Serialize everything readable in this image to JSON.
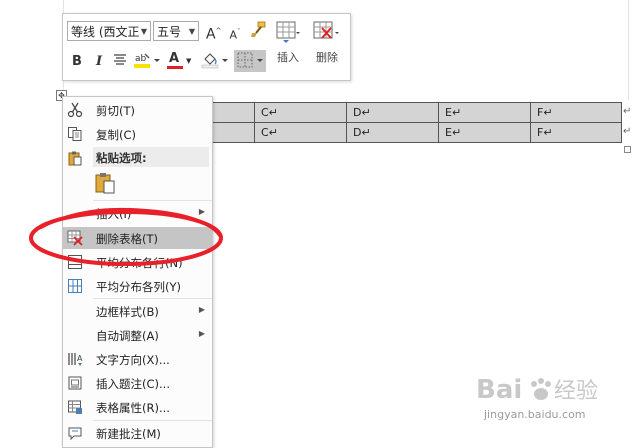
{
  "toolbar": {
    "font_name": "等线 (西文正",
    "font_size": "五号",
    "grow_font": "A",
    "shrink_font": "A",
    "bold": "B",
    "italic": "I",
    "font_color_letter": "A",
    "insert_label": "插入",
    "delete_label": "删除"
  },
  "table": {
    "rows": [
      [
        "",
        "C↵",
        "D↵",
        "E↵",
        "F↵"
      ],
      [
        "",
        "C↵",
        "D↵",
        "E↵",
        "F↵"
      ]
    ],
    "row_end_mark": "↵"
  },
  "context_menu": {
    "items": [
      {
        "label": "剪切(T)",
        "icon": "scissors-icon"
      },
      {
        "label": "复制(C)",
        "icon": "copy-icon"
      },
      {
        "label": "粘贴选项:",
        "icon": "clipboard-icon"
      },
      {
        "label": "插入(I)",
        "icon": "",
        "submenu": true
      },
      {
        "label": "删除表格(T)",
        "icon": "delete-table-icon"
      },
      {
        "label": "平均分布各行(N)",
        "icon": "distribute-rows-icon"
      },
      {
        "label": "平均分布各列(Y)",
        "icon": "distribute-columns-icon"
      },
      {
        "label": "边框样式(B)",
        "icon": "",
        "submenu": true
      },
      {
        "label": "自动调整(A)",
        "icon": "",
        "submenu": true
      },
      {
        "label": "文字方向(X)...",
        "icon": "text-direction-icon"
      },
      {
        "label": "插入题注(C)...",
        "icon": "caption-icon"
      },
      {
        "label": "表格属性(R)...",
        "icon": "table-properties-icon"
      },
      {
        "label": "新建批注(M)",
        "icon": "new-comment-icon"
      }
    ]
  },
  "colors": {
    "annotation_red": "#e8202a",
    "highlight": "#c5c5c5",
    "table_fill": "#d4d4d4",
    "highlighter_yellow": "#f5e400",
    "font_red": "#e02020"
  },
  "watermark": {
    "text": "jingyan.baidu.com"
  }
}
